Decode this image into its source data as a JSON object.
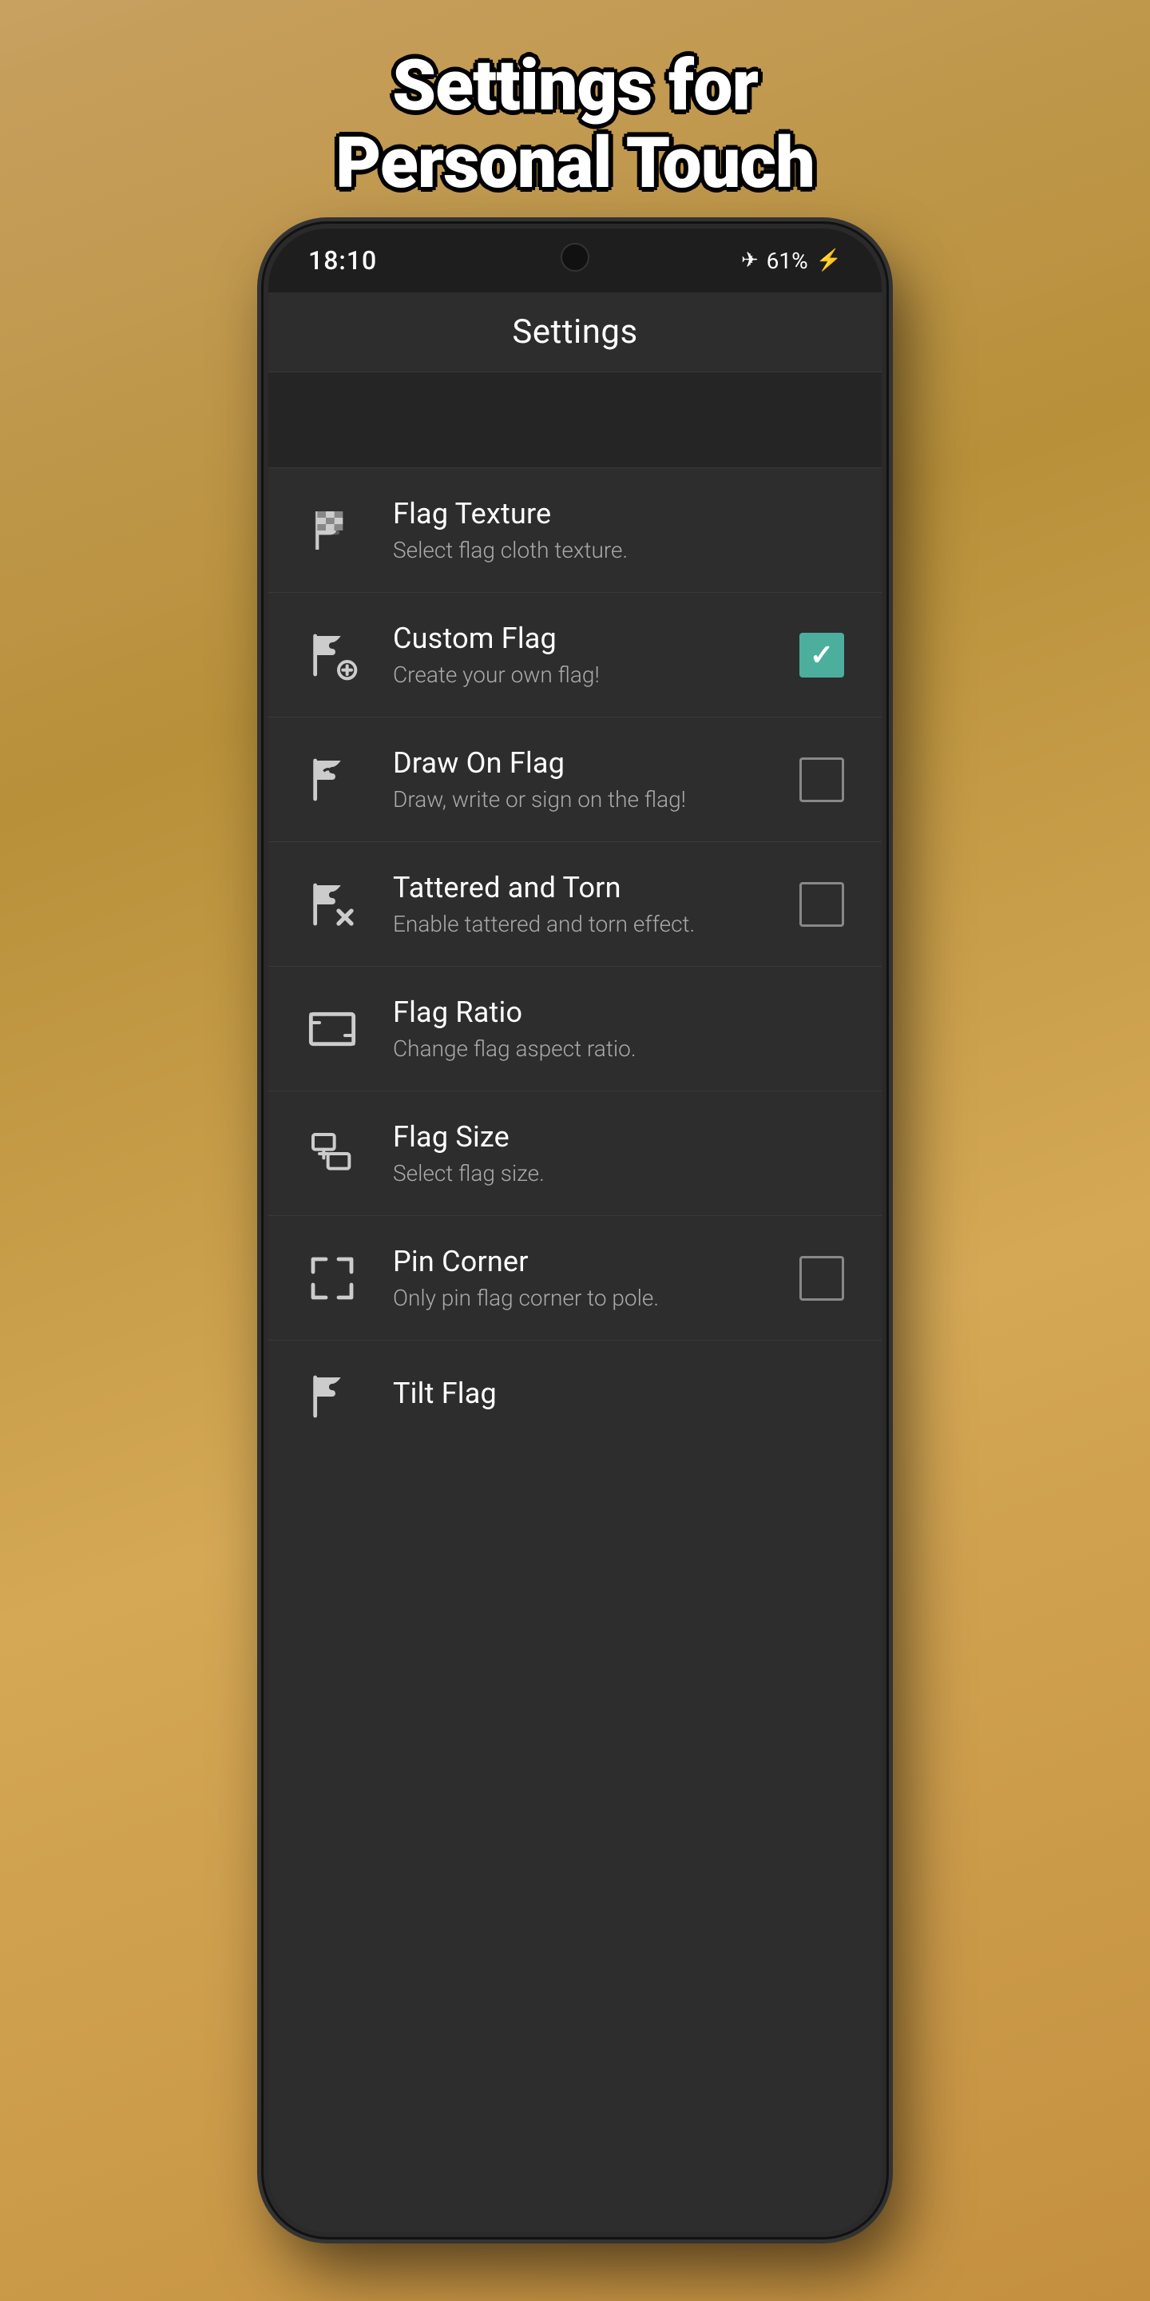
{
  "page": {
    "title_line1": "Settings for",
    "title_line2": "Personal Touch"
  },
  "status_bar": {
    "time": "18:10",
    "battery_percent": "61%",
    "battery_icon": "⚡",
    "signal_icon": "✈"
  },
  "toolbar": {
    "title": "Settings"
  },
  "settings_items": [
    {
      "id": "flag-texture",
      "title": "Flag Texture",
      "subtitle": "Select flag cloth texture.",
      "has_checkbox": false,
      "checked": false,
      "icon_type": "flag-texture"
    },
    {
      "id": "custom-flag",
      "title": "Custom Flag",
      "subtitle": "Create your own flag!",
      "has_checkbox": true,
      "checked": true,
      "icon_type": "flag-plus"
    },
    {
      "id": "draw-on-flag",
      "title": "Draw On Flag",
      "subtitle": "Draw, write or sign on the flag!",
      "has_checkbox": true,
      "checked": false,
      "icon_type": "flag-draw"
    },
    {
      "id": "tattered-torn",
      "title": "Tattered and Torn",
      "subtitle": "Enable tattered and torn effect.",
      "has_checkbox": true,
      "checked": false,
      "icon_type": "flag-torn"
    },
    {
      "id": "flag-ratio",
      "title": "Flag Ratio",
      "subtitle": "Change flag aspect ratio.",
      "has_checkbox": false,
      "checked": false,
      "icon_type": "aspect-ratio"
    },
    {
      "id": "flag-size",
      "title": "Flag Size",
      "subtitle": "Select flag size.",
      "has_checkbox": false,
      "checked": false,
      "icon_type": "flag-size"
    },
    {
      "id": "pin-corner",
      "title": "Pin Corner",
      "subtitle": "Only pin flag corner to pole.",
      "has_checkbox": true,
      "checked": false,
      "icon_type": "pin-corner"
    },
    {
      "id": "tilt-flag",
      "title": "Tilt Flag",
      "subtitle": "",
      "has_checkbox": false,
      "checked": false,
      "icon_type": "tilt-flag",
      "partial": true
    }
  ]
}
